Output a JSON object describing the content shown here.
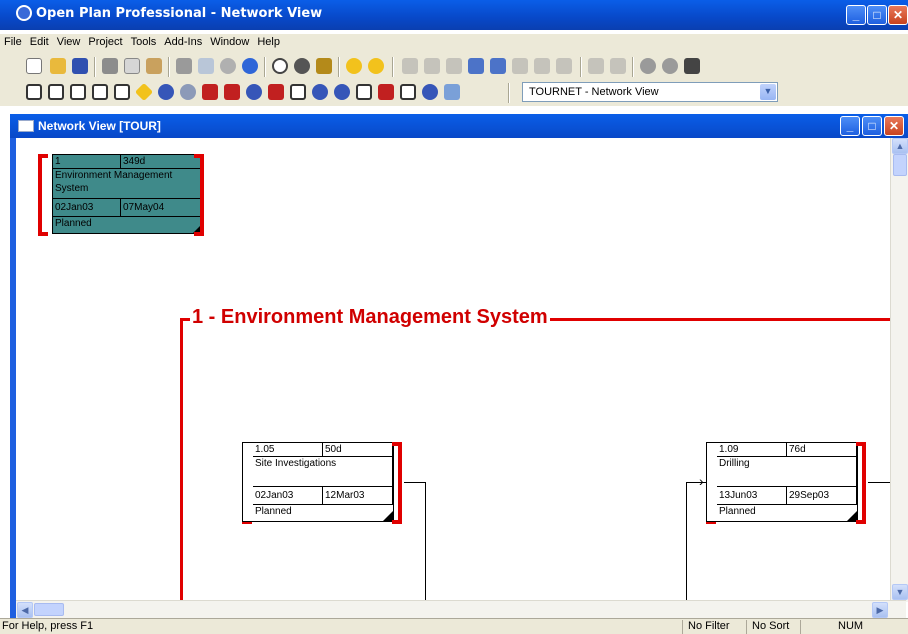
{
  "app": {
    "title": "Open Plan Professional - Network View"
  },
  "menu": [
    "File",
    "Edit",
    "View",
    "Project",
    "Tools",
    "Add-Ins",
    "Window",
    "Help"
  ],
  "view_combo": {
    "value": "TOURNET - Network View"
  },
  "child_window": {
    "title": "Network View [TOUR]"
  },
  "group": {
    "label": "1 - Environment Management System"
  },
  "nodes": [
    {
      "id": "1",
      "duration": "349d",
      "name": "Environment Management System",
      "start": "02Jan03",
      "finish": "07May04",
      "status": "Planned"
    },
    {
      "id": "1.05",
      "duration": "50d",
      "name": "Site Investigations",
      "start": "02Jan03",
      "finish": "12Mar03",
      "status": "Planned"
    },
    {
      "id": "1.09",
      "duration": "76d",
      "name": "Drilling",
      "start": "13Jun03",
      "finish": "29Sep03",
      "status": "Planned"
    }
  ],
  "status": {
    "help": "For Help, press F1",
    "filter": "No Filter",
    "sort": "No Sort",
    "num": "NUM"
  },
  "colors": {
    "summary_fill": "#3f8a8a",
    "bracket": "#e00000",
    "title_blue": "#0a5ee8"
  },
  "icons": {
    "toolbar1": [
      "new-icon",
      "open-icon",
      "save-icon",
      "cut-icon",
      "copy-icon",
      "paste-icon",
      "print-icon",
      "print-preview-icon",
      "undo-icon",
      "help-icon",
      "clock-icon",
      "globe-icon",
      "chart-icon",
      "number-one-icon",
      "percent-icon",
      "add-icon",
      "remove-icon",
      "link-icon",
      "unlink-icon",
      "arrow-down-icon",
      "arrow-up-icon",
      "arrow-left-icon",
      "arrow-right-icon",
      "indent-icon",
      "outdent-icon",
      "zoom-in-icon",
      "zoom-out-icon",
      "camera-icon"
    ],
    "toolbar2": [
      "network-node-icon",
      "network-node-icon",
      "network-node-icon",
      "network-node-icon",
      "network-node-icon",
      "diamond-icon",
      "shield-icon",
      "sphere-icon",
      "cube-icon",
      "cube-icon",
      "shield-icon",
      "cube-icon",
      "network-node-icon",
      "shield-icon",
      "shield-icon",
      "network-node-icon",
      "cube-icon",
      "network-node-icon",
      "shield-icon",
      "document-icon"
    ]
  }
}
